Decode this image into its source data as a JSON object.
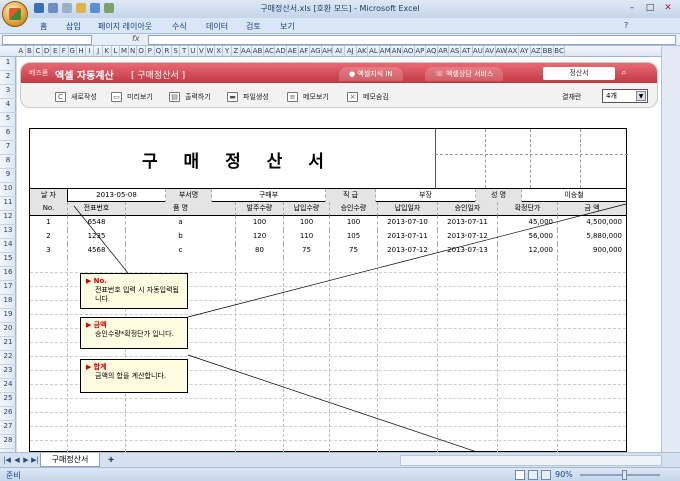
{
  "window": {
    "title": "구매정산서.xls  [호환 모드] - Microsoft Excel"
  },
  "menu": [
    "홈",
    "삽입",
    "페이지 레이아웃",
    "수식",
    "데이터",
    "검토",
    "보기"
  ],
  "formula_bar": {
    "fx": "fx",
    "name_box": "",
    "value": ""
  },
  "columns": [
    "A",
    "B",
    "C",
    "D",
    "E",
    "F",
    "G",
    "H",
    "I",
    "J",
    "K",
    "L",
    "M",
    "N",
    "O",
    "P",
    "Q",
    "R",
    "S",
    "T",
    "U",
    "V",
    "W",
    "X",
    "Y",
    "Z",
    "AA",
    "AB",
    "AC",
    "AD",
    "AE",
    "AF",
    "AG",
    "AH",
    "AI",
    "AJ",
    "AK",
    "AL",
    "AM",
    "AN",
    "AO",
    "AP",
    "AQ",
    "AR",
    "AS",
    "AT",
    "AU",
    "AV",
    "AW",
    "AX",
    "AY",
    "AZ",
    "BB",
    "BC"
  ],
  "rows": [
    "1",
    "2",
    "3",
    "4",
    "5",
    "6",
    "7",
    "8",
    "9",
    "10",
    "11",
    "12",
    "13",
    "14",
    "15",
    "16",
    "17",
    "18",
    "19",
    "20",
    "21",
    "22",
    "23",
    "24",
    "25",
    "26",
    "27",
    "28"
  ],
  "ribbon": {
    "brand_small": "베즈폼",
    "brand": "엑셀 자동계산",
    "subtitle": "[ 구매정산서 ]",
    "tab1": "엑셀지식 IN",
    "tab2": "엑셀상담 서비스",
    "search_placeholder": "정산서",
    "buttons": [
      "새로작성",
      "미리보기",
      "출력하기",
      "파일생성",
      "메모보기",
      "메모숨김"
    ],
    "result_label": "결재란",
    "result_value": "4개"
  },
  "document": {
    "title": "구 매 정 산 서",
    "info": {
      "date_label": "날 자",
      "date_value": "2013-05-08",
      "dept_label": "부서명",
      "dept_value": "구매부",
      "rank_label": "직 급",
      "rank_value": "부장",
      "name_label": "성 명",
      "name_value": "이승철"
    },
    "columns": [
      "No.",
      "전표번호",
      "품          명",
      "발주수량",
      "납입수량",
      "승인수량",
      "납입일자",
      "승인일자",
      "확정단가",
      "금          액"
    ],
    "rows": [
      [
        "1",
        "6548",
        "a",
        "100",
        "100",
        "100",
        "2013-07-10",
        "2013-07-11",
        "45,000",
        "4,500,000"
      ],
      [
        "2",
        "1235",
        "b",
        "120",
        "110",
        "105",
        "2013-07-11",
        "2013-07-12",
        "56,000",
        "5,880,000"
      ],
      [
        "3",
        "4568",
        "c",
        "80",
        "75",
        "75",
        "2013-07-12",
        "2013-07-13",
        "12,000",
        "900,000"
      ]
    ],
    "notes": [
      {
        "title": "No.",
        "text": "전표번호 입력 시 자동입력됩니다."
      },
      {
        "title": "금액",
        "text": "승인수량*확정단가 입니다."
      },
      {
        "title": "합계",
        "text": "금액의 합을 계산합니다."
      }
    ]
  },
  "sheet_tab": "구매정산서",
  "status": {
    "text": "준비",
    "zoom": "90%"
  }
}
